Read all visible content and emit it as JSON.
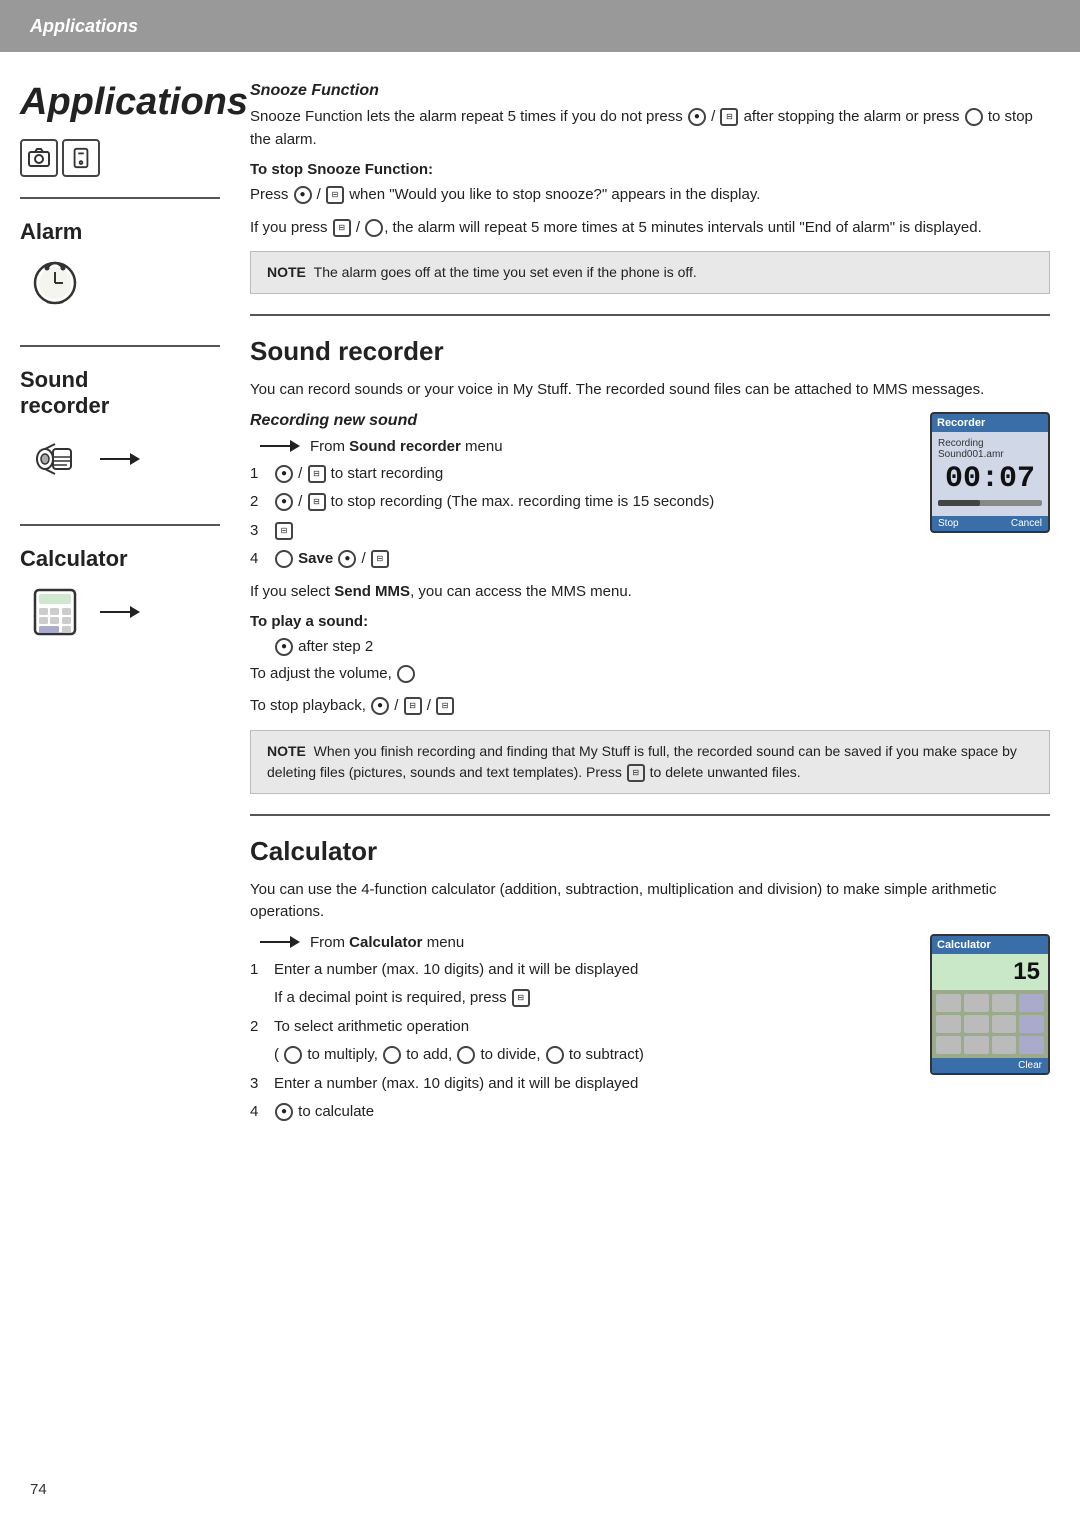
{
  "header": {
    "label": "Applications"
  },
  "sidebar": {
    "title": "Applications",
    "alarm_label": "Alarm",
    "sound_recorder_label": "Sound\nrecorder",
    "calculator_label": "Calculator"
  },
  "alarm_section": {
    "snooze_title": "Snooze Function",
    "snooze_body": "Snooze Function lets the alarm repeat 5 times if you do not press",
    "snooze_body2": "/ ⎘ after stopping the alarm or press Ⓢ to stop the alarm.",
    "stop_title": "To stop Snooze Function:",
    "stop_body1": "Press ● / ⎘ when “Would you like to stop snooze?” appears in the display.",
    "stop_body2": "If you press ⎘ / Ⓢ, the alarm will repeat 5 more times at 5 minutes intervals until “End of alarm” is displayed.",
    "note_label": "NOTE",
    "note_text": "The alarm goes off at the time you set even if the phone is off."
  },
  "sound_recorder_section": {
    "title": "Sound recorder",
    "intro": "You can record sounds or your voice in My Stuff. The recorded sound files can be attached to MMS messages.",
    "recording_title": "Recording new sound",
    "from_menu": "From Sound recorder menu",
    "steps": [
      {
        "num": "1",
        "text": "/ ⎘ to start recording"
      },
      {
        "num": "2",
        "text": "/ ⎘ to stop recording (The max. recording time is 15 seconds)"
      },
      {
        "num": "3",
        "text": "⎘"
      },
      {
        "num": "4",
        "text": "Ⓢ Save ● / ⎘"
      }
    ],
    "send_mms": "If you select Send MMS, you can access the MMS menu.",
    "play_title": "To play a sound:",
    "play_step1": "● after step 2",
    "play_adjust": "To adjust the volume, Ⓢ",
    "play_stop": "To stop playback, ● / ⎘ / ⎘",
    "note_label": "NOTE",
    "note_text": "When you finish recording and finding that My Stuff is full, the recorded sound can be saved if you make space by deleting files (pictures, sounds and text templates). Press ⎘ to delete unwanted files.",
    "phone_header": "Recorder",
    "phone_subtext": "Recording\nSound001.amr",
    "phone_time": "00:07",
    "phone_stop": "Stop",
    "phone_cancel": "Cancel"
  },
  "calculator_section": {
    "title": "Calculator",
    "intro": "You can use the 4-function calculator (addition, subtraction, multiplication and division) to make simple arithmetic operations.",
    "from_menu": "From Calculator  menu",
    "steps": [
      {
        "num": "1",
        "text": "Enter a number (max. 10 digits) and it will be displayed"
      },
      {
        "num": "",
        "text": "If a decimal point is required, press ⎘"
      },
      {
        "num": "2",
        "text": "To select arithmetic operation"
      },
      {
        "num": "",
        "text": "( Ⓢ to multiply, Ⓢ to add, Ⓢ to divide, Ⓢ to subtract)"
      },
      {
        "num": "3",
        "text": "Enter a number (max. 10 digits) and it will be displayed"
      },
      {
        "num": "4",
        "text": "● to calculate"
      }
    ],
    "phone_header": "Calculator",
    "phone_number": "15",
    "phone_clear": "Clear"
  },
  "page_number": "74"
}
